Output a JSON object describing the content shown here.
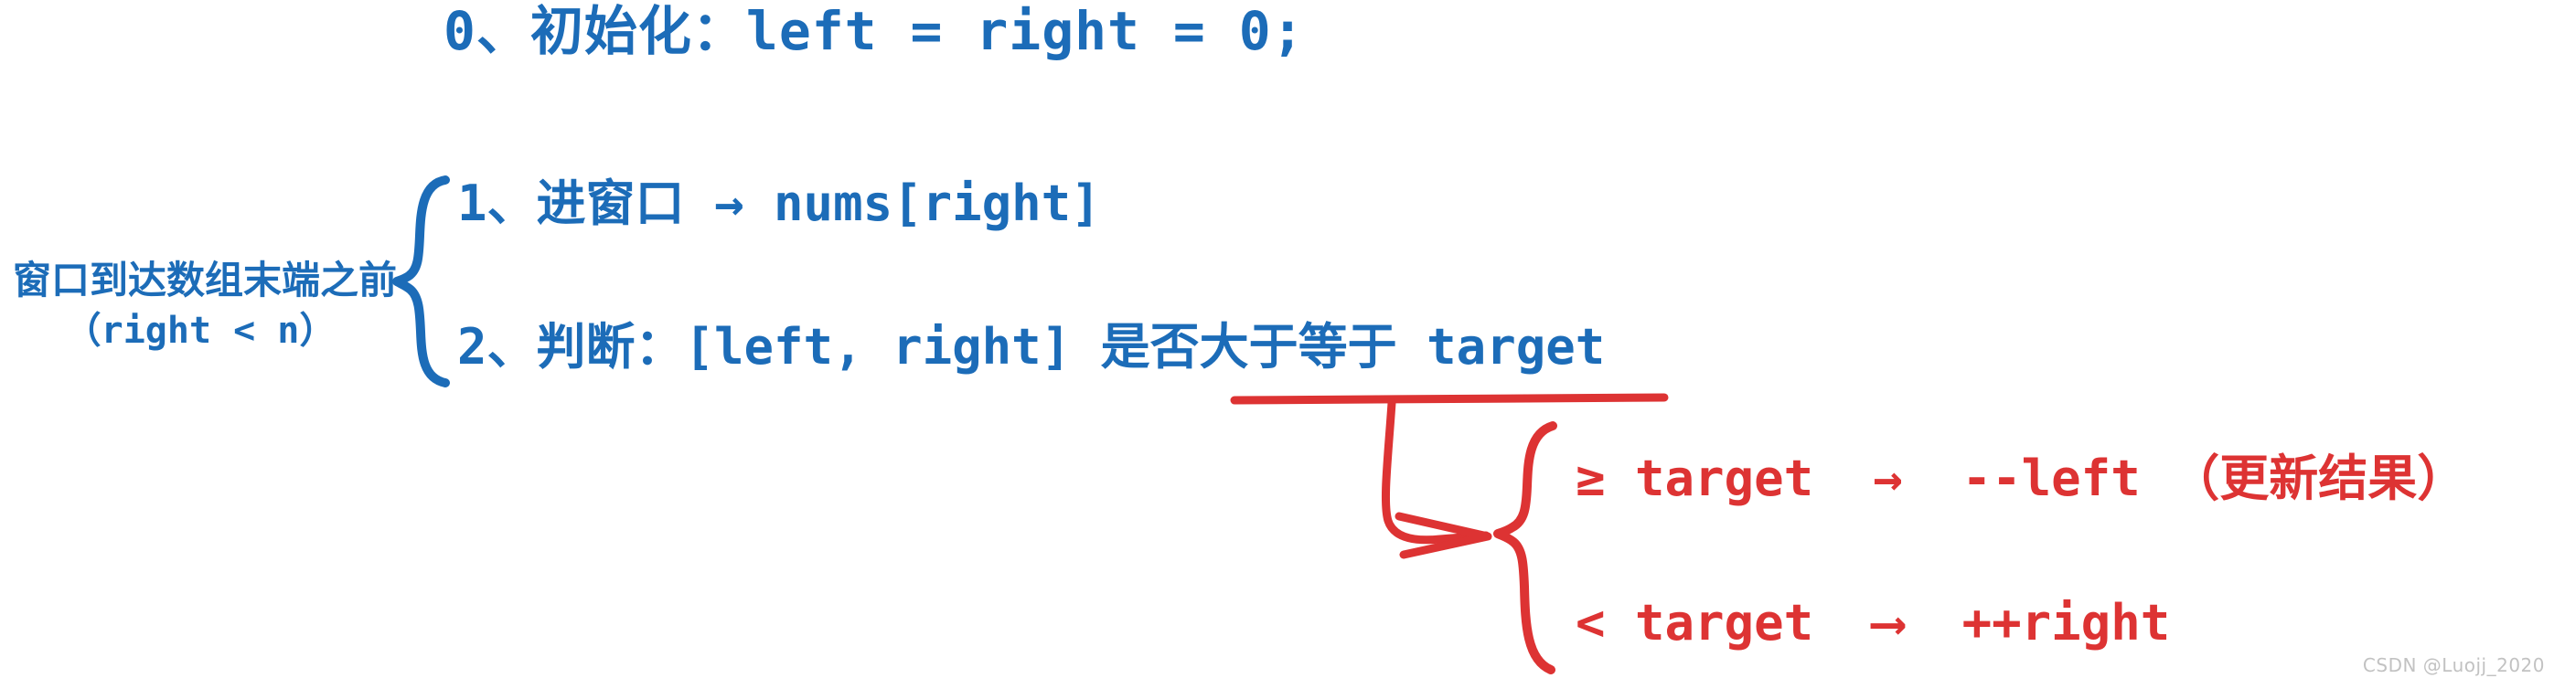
{
  "diagram": {
    "title_line": "0、初始化：left = right = 0;",
    "condition": {
      "label": "窗口到达数组末端之前",
      "sub": "（right < n）"
    },
    "steps": [
      {
        "text": "1、进窗口 → nums[right]"
      },
      {
        "text": "2、判断：[left, right] 是否大于等于 target"
      }
    ],
    "branches": [
      {
        "text": "≥ target  →  --left （更新结果）"
      },
      {
        "text": "< target  ⟶  ++right"
      }
    ],
    "colors": {
      "blue": "#1c6cb8",
      "red": "#dd3333",
      "watermark": "#c2c2c2",
      "background": "#ffffff"
    },
    "watermark": "CSDN @Luojj_2020"
  }
}
